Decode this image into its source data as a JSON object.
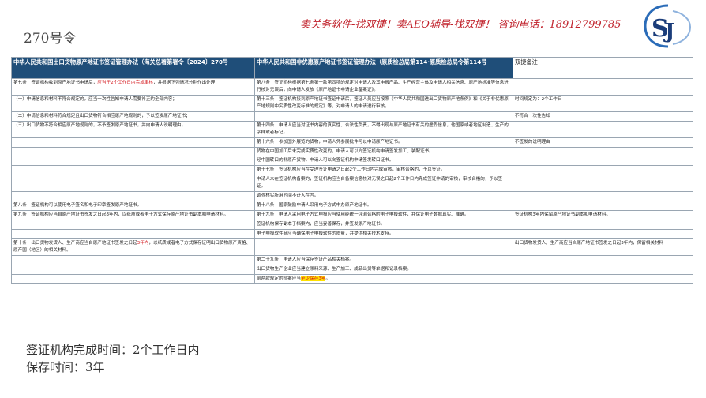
{
  "slide_title": "270号令",
  "banner": "卖关务软件-找双捷！卖AEO辅导-找双捷！ 咨询电话：18912799785",
  "logo": {
    "icon": "sj-logo-mark",
    "text": "双捷"
  },
  "table": {
    "headers": [
      "中华人民共和国出口货物原产地证书签证管理办法（海关总署第署令〔2024〕270号",
      "中华人民共和国非优惠原产地证书签证管理办法（原质检总局第114·原质检总局令第114号",
      "双捷备注"
    ],
    "rows": [
      [
        "第七条　签证机构收到原产地证书申请后，应当于2个工作日内完成审核，并根据下列情况分别作出处理：",
        "第八条　签证机构根据第七条第一款第四项的规定对申请人及其申报产品、生产经营主体及申请人相关信息、原产地标准等信息进行核对无误后，向申请人发放《原产地证书申请企业备案证》。",
        ""
      ],
      [
        "（一）申请信息和材料不符合规定的，应当一次性告知申请人需要补正的全部内容；",
        "第十三条　签证机构接到原产地证书签证申请后，签证人员应当按照《中华人民共和国进出口货物原产地条例》和《关于非优惠原产地规则中实质性改变标准的规定》等，对申请人的申请进行审核。",
        "时间规定为：2个工作日"
      ],
      [
        "（二）申请信息和材料符合规定且出口货物符合相应原产地规则的，予以签发原产地证书；",
        "",
        "不符合一次性告知"
      ],
      [
        "（三）出口货物不符合相应原产地规则的，不予签发原产地证书，并向申请人说明理由。",
        "第十四条　申请人应当对证书内容的真实性、合法性负责，不得出现与原产地证书有关的虚假信息，他国家或者地区制造、生产的字样或者标记。",
        ""
      ],
      [
        "",
        "第十六条　参加国外展览的货物，申请人凭参展批件可以申请原产地证书。",
        "不签发的说明理由"
      ],
      [
        "",
        "货物在中国加工后未完成实质性改变的，申请人可以向签证机构申请签发加工、装配证书。",
        ""
      ],
      [
        "",
        "经中国转口的非原产货物，申请人可以向签证机构申请签发转口证书。",
        ""
      ],
      [
        "",
        "第十七条　签证机构应当在受理签证申请之日起2个工作日内完成审核，审核合格的，予以签证。",
        ""
      ],
      [
        "",
        "申请人未在签证机构备案的，签证机构应当自备案信息核对无误之日起2个工作日内完成签证申请的审核，审核合格的，予以签证。",
        ""
      ],
      [
        "",
        "调查核实所用时间不计入在内。",
        ""
      ],
      [
        "第八条　签证机构可以使用电子签名和电子印章签发原产地证书。",
        "第十八条　国家鼓励申请人采用电子方式申办原产地证书。",
        ""
      ],
      [
        "第九条　签证机构应当自原产地证书签发之日起3年内，以纸质或者电子方式保存原产地证书副本和申请材料。",
        "第十九条　申请人采用电子方式申报应当使用经统一评测合格的电子申报软件，并保证电子数据真实、准确。",
        "签证机构3年内保留原产地证书副本和申请材料。"
      ],
      [
        "",
        "签证机构保存副本于档案内，应当妥善保存，并签发原产地证书。",
        ""
      ],
      [
        "",
        "电子申报软件商应当确保电子申报软件的质量，并提供相关技术支持。",
        ""
      ],
      [
        "第十条　出口货物发货人、生产商应当自原产地证书签发之日起3年内，以纸质或者电子方式保存证明出口货物原产资格、原产国（地区）的相关材料。",
        "",
        "出口货物发货人、生产商应当自原产地证书签发之日起3年内，保留相关材料"
      ],
      [
        "",
        "第二十九条　申请人应当保存签证产品相关档案。",
        ""
      ],
      [
        "",
        "出口货物生产企业应当建立原料来源、生产加工、成品出货等单据和记录档案。",
        ""
      ],
      [
        "",
        "前两款规定的档案应当至少保存3年。",
        ""
      ]
    ]
  },
  "bottom": {
    "line1": "签证机构完成时间：2个工作日内",
    "line2": "保存时间：3年"
  },
  "colors": {
    "header_bg": "#1f4e79",
    "accent_red": "#d4141a",
    "highlight_yellow": "#ffe100"
  }
}
